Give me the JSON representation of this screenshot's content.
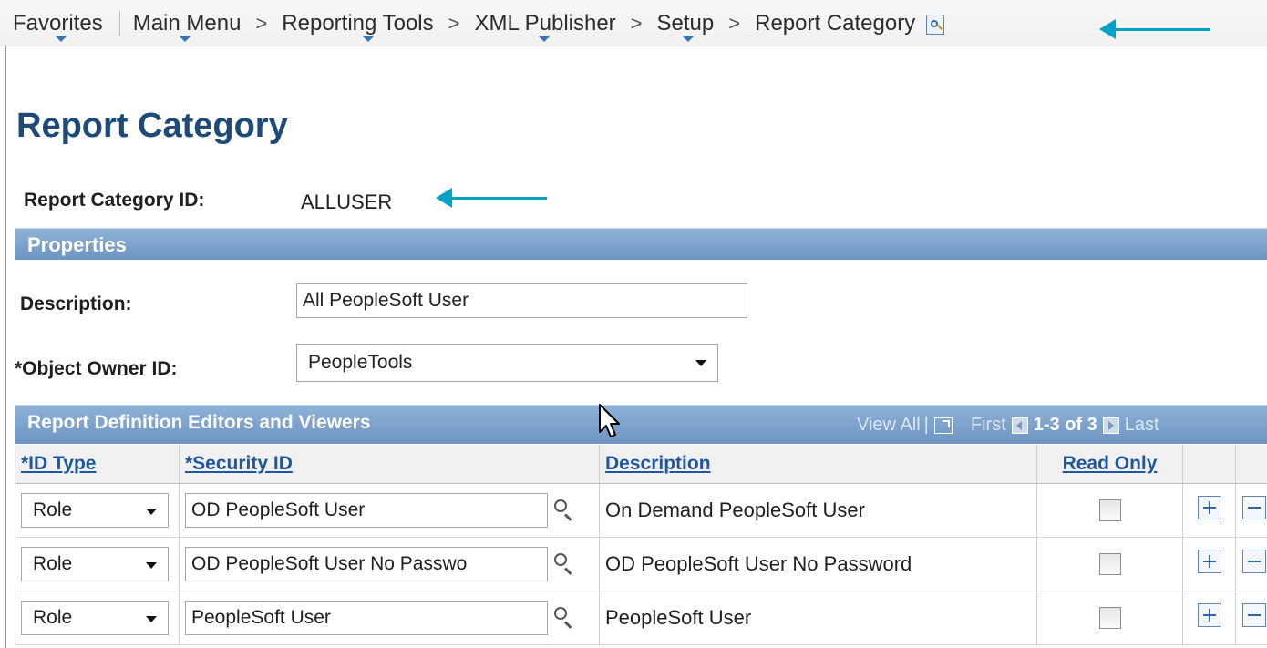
{
  "breadcrumb": {
    "items": [
      "Favorites",
      "Main Menu",
      "Reporting Tools",
      "XML Publisher",
      "Setup",
      "Report Category"
    ],
    "separator": ">"
  },
  "page": {
    "title": "Report Category",
    "category_id_label": "Report Category ID:",
    "category_id_value": "ALLUSER"
  },
  "properties": {
    "section_title": "Properties",
    "description_label": "Description:",
    "description_value": "All PeopleSoft User",
    "owner_label": "*Object Owner ID:",
    "owner_value": "PeopleTools"
  },
  "grid": {
    "title": "Report Definition Editors and Viewers",
    "nav": {
      "view_all": "View All",
      "separator": "|",
      "first": "First",
      "range": "1-3 of 3",
      "last": "Last"
    },
    "columns": [
      "*ID Type",
      "*Security ID",
      "Description",
      "Read Only"
    ],
    "rows": [
      {
        "id_type": "Role",
        "security_id": "OD PeopleSoft User",
        "description": "On Demand PeopleSoft  User",
        "read_only": false
      },
      {
        "id_type": "Role",
        "security_id": "OD PeopleSoft User No Passwo",
        "description": "OD PeopleSoft User No Password",
        "read_only": false
      },
      {
        "id_type": "Role",
        "security_id": "PeopleSoft User",
        "description": "PeopleSoft User",
        "read_only": false
      }
    ]
  },
  "colors": {
    "title_blue": "#1e4a7a",
    "section_bar": "#7aa0c9",
    "link_blue": "#1d57a3",
    "annotation_arrow": "#00a2c6"
  },
  "icons": {
    "search_page": "search-page-icon",
    "lookup": "magnifier-icon",
    "add": "plus-icon",
    "remove": "minus-icon",
    "zoom": "popup-window-icon"
  }
}
